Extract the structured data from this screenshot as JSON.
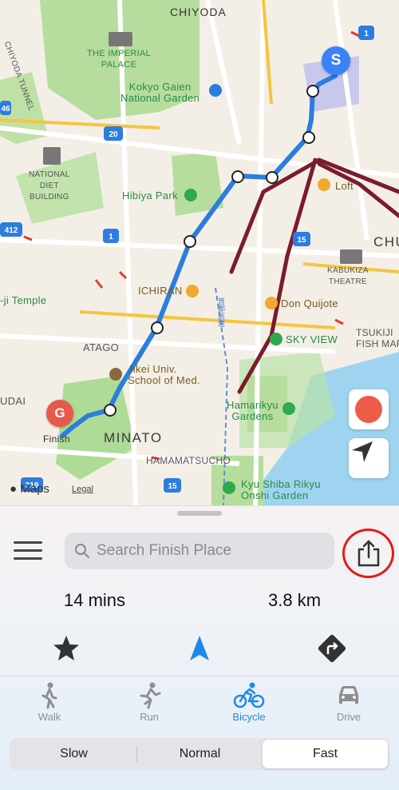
{
  "map": {
    "labels": {
      "chiyoda": "CHIYODA",
      "imperial_palace": "THE IMPERIAL\nPALACE",
      "chiyoda_tunnel": "CHIYODA TUNNEL",
      "kokyo_gaien": "Kokyo Gaien\nNational Garden",
      "national_diet": "NATIONAL\nDIET\nBUILDING",
      "hibiya_park": "Hibiya Park",
      "loft": "Loft",
      "chu": "CHU",
      "kabukiza": "KABUKIZA\nTHEATRE",
      "ichiran": "ICHIRAN",
      "ji_temple": "-ji Temple",
      "don_quijote": "Don Quijote",
      "sky_view": "SKY VIEW",
      "tsukiji": "TSUKIJI\nFISH MARKE",
      "atago": "ATAGO",
      "jikei": "Jikei Univ.\nSchool of Med.",
      "hamarikyu": "Hamarikyu\nGardens",
      "udai": "UDAI",
      "finish": "Finish",
      "minato": "MINATO",
      "hamamatsucho": "HAMAMATSUCHO",
      "kyu_shiba": "Kyu Shiba Rikyu\nOnshi Garden",
      "expressway": "首都高速"
    },
    "shields": {
      "r1_top": "1",
      "r1_mid": "1",
      "r20": "20",
      "r46": "46",
      "r412": "412",
      "r15a": "15",
      "r15b": "15",
      "r319": "319"
    },
    "start_pin": "S",
    "goal_pin": "G",
    "maps_logo": "Maps",
    "legal": "Legal"
  },
  "panel": {
    "search_placeholder": "Search Finish Place",
    "duration": "14 mins",
    "distance": "3.8 km",
    "modes": [
      {
        "label": "Walk",
        "icon": "walk-icon"
      },
      {
        "label": "Run",
        "icon": "run-icon"
      },
      {
        "label": "Bicycle",
        "icon": "bicycle-icon"
      },
      {
        "label": "Drive",
        "icon": "car-icon"
      }
    ],
    "active_mode": "Bicycle",
    "speeds": [
      "Slow",
      "Normal",
      "Fast"
    ],
    "selected_speed": "Fast"
  },
  "colors": {
    "accent": "#1e88e5",
    "route": "#2b7de0",
    "start_pin": "#3b82f6",
    "goal_pin": "#e7594a",
    "record": "#ee5b4a",
    "highlight_ring": "#e21a1a"
  }
}
